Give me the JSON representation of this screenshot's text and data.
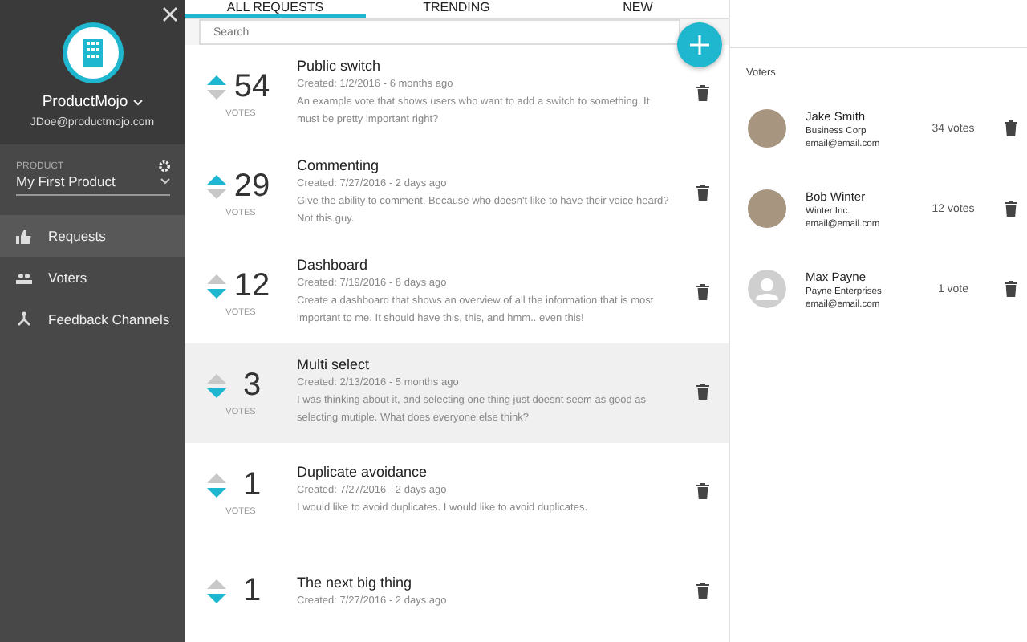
{
  "sidebar": {
    "brand": "ProductMojo",
    "email": "JDoe@productmojo.com",
    "product_label": "PRODUCT",
    "product": "My First Product",
    "items": [
      {
        "label": "Requests",
        "kind": "thumb",
        "selected": true
      },
      {
        "label": "Voters",
        "kind": "people",
        "selected": false
      },
      {
        "label": "Feedback Channels",
        "kind": "fork",
        "selected": false
      }
    ]
  },
  "tabs": [
    {
      "label": "ALL REQUESTS",
      "selected": true
    },
    {
      "label": "TRENDING",
      "selected": false
    },
    {
      "label": "NEW",
      "selected": false
    }
  ],
  "search": {
    "placeholder": "Search"
  },
  "requests": [
    {
      "count": "54",
      "votes_label": "VOTES",
      "upvoted": true,
      "title": "Public switch",
      "created": "Created: 1/2/2016 - 6 months ago",
      "description": "An example vote that shows users who want to add a switch to something. It must be pretty important right?",
      "selected": false
    },
    {
      "count": "29",
      "votes_label": "VOTES",
      "upvoted": true,
      "title": "Commenting",
      "created": "Created: 7/27/2016 - 2 days ago",
      "description": "Give the ability to comment. Because who doesn't like to have their voice heard? Not this guy.",
      "selected": false
    },
    {
      "count": "12",
      "votes_label": "VOTES",
      "upvoted": false,
      "title": "Dashboard",
      "created": "Created: 7/19/2016 - 8 days ago",
      "description": "Create a dashboard that shows an overview of all the information that is most important to me. It should have this, this, and hmm.. even this!",
      "selected": false
    },
    {
      "count": "3",
      "votes_label": "VOTES",
      "upvoted": false,
      "title": "Multi select",
      "created": "Created: 2/13/2016 - 5 months ago",
      "description": "I was thinking about it, and selecting one thing just doesnt seem as good as selecting mutiple. What does everyone else think?",
      "selected": true
    },
    {
      "count": "1",
      "votes_label": "VOTES",
      "upvoted": false,
      "title": "Duplicate avoidance",
      "created": "Created: 7/27/2016 - 2 days ago",
      "description": "I would like to avoid duplicates. I would like to avoid duplicates.",
      "selected": false
    },
    {
      "count": "1",
      "upvoted": false,
      "title": "The next big thing",
      "created": "Created: 7/27/2016 - 2 days ago",
      "selected": false
    }
  ],
  "voters_title": "Voters",
  "voters": [
    {
      "name": "Jake Smith",
      "company": "Business Corp",
      "email": "email@email.com",
      "votes": "34 votes",
      "kind": "photo"
    },
    {
      "name": "Bob Winter",
      "company": "Winter Inc.",
      "email": "email@email.com",
      "votes": "12 votes",
      "kind": "photo"
    },
    {
      "name": "Max Payne",
      "company": "Payne Enterprises",
      "email": "email@email.com",
      "votes": "1 vote",
      "kind": "default"
    }
  ]
}
